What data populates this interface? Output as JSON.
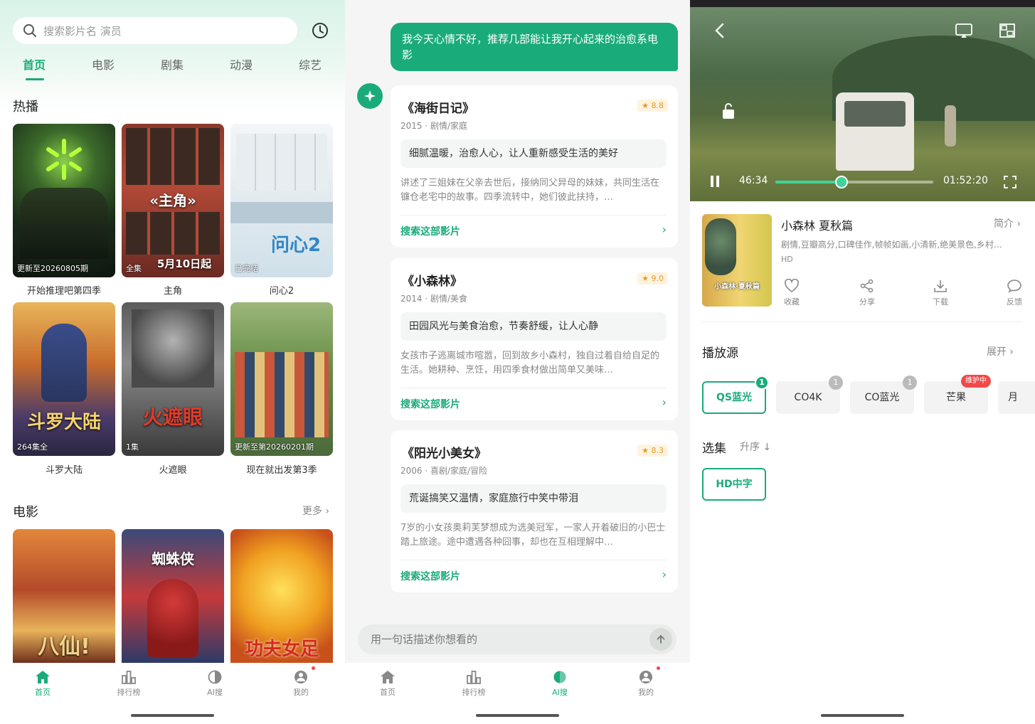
{
  "home": {
    "search_placeholder": "搜索影片名 演员",
    "tabs": [
      "首页",
      "电影",
      "剧集",
      "动漫",
      "综艺"
    ],
    "hot_title": "热播",
    "hot": [
      {
        "name": "开始推理吧第四季",
        "badge": "更新至20260805期"
      },
      {
        "name": "主角",
        "badge": "全集",
        "poster_text": "5月10日起",
        "poster_title": "«主角»"
      },
      {
        "name": "问心2",
        "badge": "已完结",
        "poster_title": "问心2"
      },
      {
        "name": "斗罗大陆",
        "badge": "264集全",
        "poster_title": "斗罗大陆"
      },
      {
        "name": "火遮眼",
        "badge": "1集",
        "poster_title": "火遮眼"
      },
      {
        "name": "现在就出发第3季",
        "badge": "更新至第20260201期"
      }
    ],
    "movie_title": "电影",
    "more": "更多",
    "movies": [
      {
        "poster_title": "八仙!"
      },
      {
        "poster_title": "蜘蛛侠"
      },
      {
        "poster_title": "功夫女足"
      }
    ]
  },
  "nav": {
    "items": [
      "首页",
      "排行榜",
      "AI搜",
      "我的"
    ]
  },
  "ai": {
    "query": "我今天心情不好，推荐几部能让我开心起来的治愈系电影",
    "search_link": "搜索这部影片",
    "input_placeholder": "用一句话描述你想看的",
    "results": [
      {
        "title": "《海街日记》",
        "rating": "★ 8.8",
        "meta": "2015 · 剧情/家庭",
        "highlight": "细腻温暖，治愈人心，让人重新感受生活的美好",
        "desc": "讲述了三姐妹在父亲去世后，接纳同父异母的妹妹，共同生活在镰仓老宅中的故事。四季流转中，她们彼此扶持，…"
      },
      {
        "title": "《小森林》",
        "rating": "★ 9.0",
        "meta": "2014 · 剧情/美食",
        "highlight": "田园风光与美食治愈，节奏舒缓，让人心静",
        "desc": "女孩市子逃离城市喧嚣，回到故乡小森村，独自过着自给自足的生活。她耕种、烹饪，用四季食材做出简单又美味…"
      },
      {
        "title": "《阳光小美女》",
        "rating": "★ 8.3",
        "meta": "2006 · 喜剧/家庭/冒险",
        "highlight": "荒诞搞笑又温情，家庭旅行中笑中带泪",
        "desc": "7岁的小女孩奥莉芙梦想成为选美冠军，一家人开着破旧的小巴士踏上旅途。途中遭遇各种囧事，却也在互相理解中…"
      }
    ]
  },
  "detail": {
    "time_current": "46:34",
    "time_total": "01:52:20",
    "progress": 0.42,
    "title": "小森林 夏秋篇",
    "intro": "简介",
    "tags": "剧情,豆瓣高分,口碑佳作,帧帧如画,小清新,绝美景色,乡村…",
    "quality": "HD",
    "poster_text": "小森林·夏秋篇",
    "actions": [
      "收藏",
      "分享",
      "下载",
      "反馈"
    ],
    "source_title": "播放源",
    "expand": "展开",
    "sources": [
      {
        "name": "QS蓝光",
        "badge": "1"
      },
      {
        "name": "CO4K",
        "badge": "1"
      },
      {
        "name": "CO蓝光",
        "badge": "1"
      },
      {
        "name": "芒果",
        "badge": "维护中"
      },
      {
        "name": "月",
        "badge": ""
      }
    ],
    "episodes_title": "选集",
    "sort": "升序",
    "episode": "HD中字"
  },
  "colors": {
    "accent": "#1aab7a",
    "rating": "#e89a25",
    "alert": "#f04a4a"
  }
}
